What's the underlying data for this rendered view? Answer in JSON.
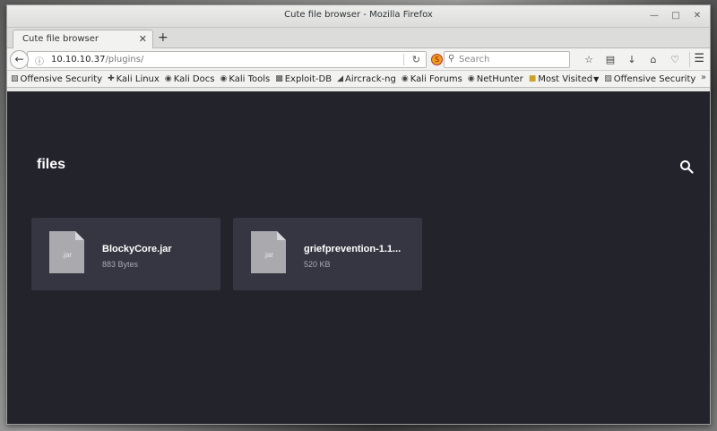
{
  "window": {
    "title": "Cute file browser - Mozilla Firefox"
  },
  "tabs": [
    {
      "label": "Cute file browser"
    }
  ],
  "navbar": {
    "url_host": "10.10.10.37",
    "url_path": "/plugins/",
    "search_placeholder": "Search"
  },
  "bookmarks": [
    {
      "label": "Offensive Security",
      "icon": "offsec-icon"
    },
    {
      "label": "Kali Linux",
      "icon": "kali-icon"
    },
    {
      "label": "Kali Docs",
      "icon": "kali-icon"
    },
    {
      "label": "Kali Tools",
      "icon": "kali-icon"
    },
    {
      "label": "Exploit-DB",
      "icon": "exploitdb-icon"
    },
    {
      "label": "Aircrack-ng",
      "icon": "aircrack-icon"
    },
    {
      "label": "Kali Forums",
      "icon": "kali-icon"
    },
    {
      "label": "NetHunter",
      "icon": "kali-icon"
    },
    {
      "label": "Most Visited",
      "icon": "folder-icon"
    },
    {
      "label": "Offensive Security",
      "icon": "offsec-icon"
    }
  ],
  "page": {
    "title": "files",
    "files": [
      {
        "ext": ".jar",
        "name": "BlockyCore.jar",
        "size": "883 Bytes"
      },
      {
        "ext": ".jar",
        "name": "griefprevention-1.1...",
        "size": "520 KB"
      }
    ]
  },
  "colors": {
    "page_bg": "#23232c",
    "card_bg": "#363643",
    "file_icon": "#a9a9ae"
  }
}
